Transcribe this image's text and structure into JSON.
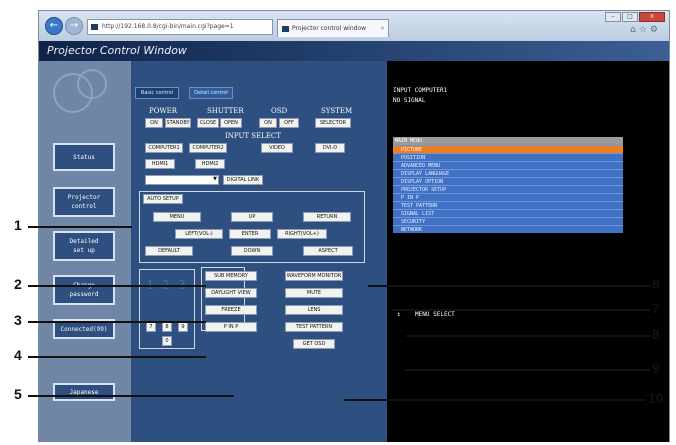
{
  "browser": {
    "address": "http://192.168.0.8/cgi-bin/main.cgi?page=1  ",
    "tab_title": "Projector control window",
    "tab_close": "×"
  },
  "page": {
    "title": "Projector Control Window"
  },
  "sidebar": {
    "status": "Status",
    "projector_control": "Projector\ncontrol",
    "detailed_setup": "Detailed\nset up",
    "change_password": "Change\npassword",
    "connected": "Connected(99)",
    "japanese": "Japanese"
  },
  "tabs": {
    "basic": "Basic control",
    "detail": "Detail control"
  },
  "groups": {
    "power": "POWER",
    "shutter": "SHUTTER",
    "osd": "OSD",
    "system": "SYSTEM",
    "input_select": "INPUT SELECT"
  },
  "buttons": {
    "on": "ON",
    "standby": "STANDBY",
    "close": "CLOSE",
    "open": "OPEN",
    "osd_on": "ON",
    "osd_off": "OFF",
    "selector": "SELECTOR",
    "computer1": "COMPUTER1",
    "computer2": "COMPUTER2",
    "video": "VIDEO",
    "dvi_d": "DVI-D",
    "hdmi1": "HDMI1",
    "hdmi2": "HDMI2",
    "digital_link": "DIGITAL LINK",
    "auto_setup": "AUTO SETUP",
    "menu": "MENU",
    "up": "UP",
    "return": "RETURN",
    "left": "LEFT(VOL-)",
    "enter": "ENTER",
    "right": "RIGHT(VOL+)",
    "default": "DEFAULT",
    "down": "DOWN",
    "aspect": "ASPECT",
    "sub_memory": "SUB MEMORY",
    "daylight_view": "DAYLIGHT VIEW",
    "freeze": "FREEZE",
    "pinp": "P IN P",
    "window_monitor": "WAVEFORM MONITOR",
    "mute": "MUTE",
    "lens": "LENS",
    "test_pattern": "TEST PATTERN",
    "get_osd": "GET OSD"
  },
  "keypad": {
    "digits": [
      "7",
      "8",
      "9",
      "0"
    ]
  },
  "monitor": {
    "line1": "INPUT COMPUTER1",
    "line2": "NO SIGNAL",
    "menu_head": "MAIN MENU",
    "menu_items": [
      "PICTURE",
      "POSITION",
      "ADVANCED MENU",
      "DISPLAY LANGUAGE",
      "DISPLAY OPTION",
      "PROJECTOR SETUP",
      "P IN P",
      "TEST PATTERN",
      "SIGNAL LIST",
      "SECURITY",
      "NETWORK"
    ],
    "footer": "↕    MENU SELECT"
  },
  "callouts": {
    "n1": "1",
    "n2": "2",
    "n3": "3",
    "n4": "4",
    "n5": "5",
    "n6": "6",
    "n7": "7",
    "n8": "8",
    "n9": "9",
    "n10": "10"
  }
}
